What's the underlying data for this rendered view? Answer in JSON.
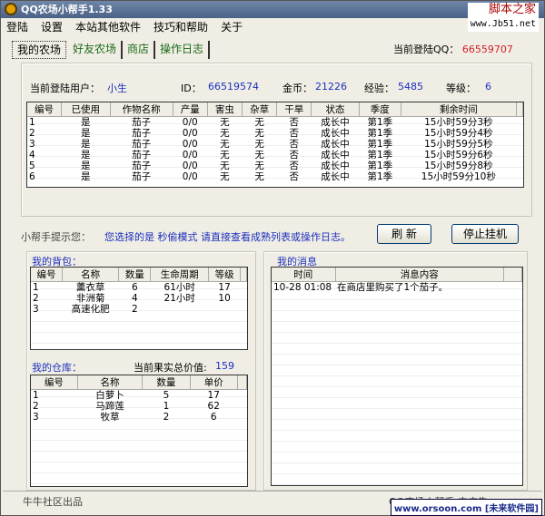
{
  "window": {
    "title": "QQ农场小帮手1.33"
  },
  "menu": [
    "登陆",
    "设置",
    "本站其他软件",
    "技巧和帮助",
    "关于"
  ],
  "tabs": [
    "我的农场",
    "好友农场",
    "商店",
    "操作日志"
  ],
  "current_qq": {
    "label": "当前登陆QQ：",
    "value": "66559707"
  },
  "user": {
    "label": "当前登陆用户：",
    "name": "小生",
    "id_label": "ID：",
    "id": "66519574",
    "gold_label": "金币：",
    "gold": "21226",
    "exp_label": "经验：",
    "exp": "5485",
    "level_label": "等级：",
    "level": "6"
  },
  "farm_table": {
    "columns": [
      "编号",
      "已使用",
      "作物名称",
      "产量",
      "害虫",
      "杂草",
      "干旱",
      "状态",
      "季度",
      "剩余时间"
    ],
    "rows": [
      [
        "1",
        "是",
        "茄子",
        "0/0",
        "无",
        "无",
        "否",
        "成长中",
        "第1季",
        "15小时59分3秒"
      ],
      [
        "2",
        "是",
        "茄子",
        "0/0",
        "无",
        "无",
        "否",
        "成长中",
        "第1季",
        "15小时59分4秒"
      ],
      [
        "3",
        "是",
        "茄子",
        "0/0",
        "无",
        "无",
        "否",
        "成长中",
        "第1季",
        "15小时59分5秒"
      ],
      [
        "4",
        "是",
        "茄子",
        "0/0",
        "无",
        "无",
        "否",
        "成长中",
        "第1季",
        "15小时59分6秒"
      ],
      [
        "5",
        "是",
        "茄子",
        "0/0",
        "无",
        "无",
        "否",
        "成长中",
        "第1季",
        "15小时59分8秒"
      ],
      [
        "6",
        "是",
        "茄子",
        "0/0",
        "无",
        "无",
        "否",
        "成长中",
        "第1季",
        "15小时59分10秒"
      ]
    ]
  },
  "hint": {
    "label": "小帮手提示您：",
    "text": "您选择的是 秒偷模式 请直接查看成熟列表或操作日志。"
  },
  "buttons": {
    "refresh": "刷 新",
    "stop": "停止挂机"
  },
  "bag": {
    "title": "我的背包：",
    "columns": [
      "编号",
      "名称",
      "数量",
      "生命周期",
      "等级"
    ],
    "rows": [
      [
        "1",
        "薰衣草",
        "6",
        "61小时",
        "17"
      ],
      [
        "2",
        "非洲菊",
        "4",
        "21小时",
        "10"
      ],
      [
        "3",
        "高速化肥",
        "2",
        "",
        ""
      ]
    ]
  },
  "warehouse": {
    "title": "我的仓库：",
    "value_label": "当前果实总价值:",
    "value": "159",
    "columns": [
      "编号",
      "名称",
      "数量",
      "单价"
    ],
    "rows": [
      [
        "1",
        "白萝卜",
        "5",
        "17"
      ],
      [
        "2",
        "马蹄莲",
        "1",
        "62"
      ],
      [
        "3",
        "牧草",
        "2",
        "6"
      ]
    ]
  },
  "messages": {
    "title": "我的消息",
    "columns": [
      "时间",
      "消息内容"
    ],
    "rows": [
      [
        "10-28 01:08",
        "在商店里购买了1个茄子。"
      ]
    ]
  },
  "status": {
    "left": "牛牛社区出品",
    "right": "QQ农场小帮手 去广告：..."
  },
  "watermarks": {
    "top_cn": "脚本之家",
    "top_url": "www.Jb51.net",
    "bottom": "www.orsoon.com [未来软件园]"
  },
  "colors": {
    "value_blue": "#1c2fbf",
    "qq_red": "#d0202a",
    "tab_green": "#1b6b1b"
  }
}
